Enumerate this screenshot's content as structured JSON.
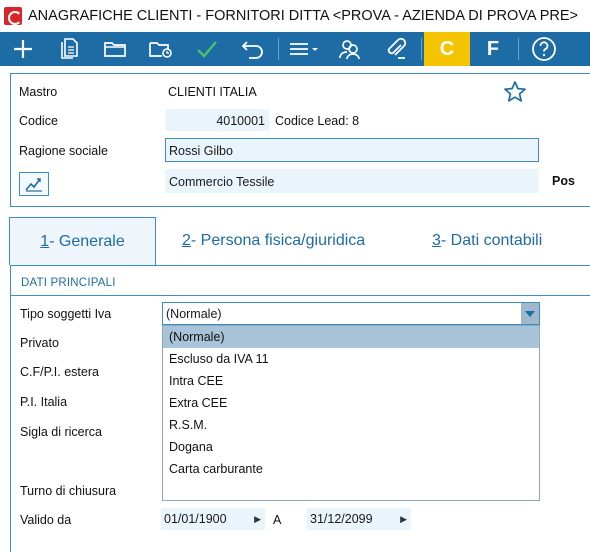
{
  "window": {
    "title": "ANAGRAFICHE CLIENTI - FORNITORI DITTA <PROVA - AZIENDA DI PROVA PRE>"
  },
  "toolbar": {
    "buttons": [
      {
        "name": "new",
        "icon": "plus-icon"
      },
      {
        "name": "copy",
        "icon": "document-icon"
      },
      {
        "name": "open",
        "icon": "folder-icon"
      },
      {
        "name": "search",
        "icon": "folder-search-icon"
      },
      {
        "name": "confirm",
        "icon": "check-icon"
      },
      {
        "name": "undo",
        "icon": "undo-icon"
      },
      {
        "name": "menu",
        "icon": "list-menu-icon"
      },
      {
        "name": "contacts",
        "icon": "people-icon"
      },
      {
        "name": "attach",
        "icon": "paperclip-icon"
      }
    ],
    "c_label": "C",
    "f_label": "F",
    "help_icon": "help-icon",
    "colors": {
      "toolbar": "#1d6ca6",
      "c_button": "#f5c400",
      "check": "#49c46a"
    }
  },
  "header": {
    "mastro_label": "Mastro",
    "mastro_value": "CLIENTI ITALIA",
    "codice_label": "Codice",
    "codice_value": "4010001",
    "codice_lead_label": "Codice Lead: 8",
    "ragione_label": "Ragione sociale",
    "ragione_value": "Rossi Gilbo",
    "descrizione_value": "Commercio Tessile",
    "pos_label": "Pos"
  },
  "tabs": [
    {
      "key": "1",
      "label": " - Generale",
      "active": true
    },
    {
      "key": "2",
      "label": " - Persona fisica/giuridica",
      "active": false
    },
    {
      "key": "3",
      "label": " - Dati contabili",
      "active": false
    }
  ],
  "section": {
    "title": "DATI PRINCIPALI"
  },
  "form": {
    "tipo_label": "Tipo soggetti Iva",
    "tipo_value": "(Normale)",
    "privato_label": "Privato",
    "cf_label": "C.F/P.I. estera",
    "pi_label": "P.I. Italia",
    "sigla_label": "Sigla di ricerca",
    "turno_label": "Turno di chiusura",
    "valido_label": "Valido da",
    "valido_da": "01/01/1900",
    "a_label": "A",
    "valido_a": "31/12/2099"
  },
  "dropdown": {
    "options": [
      "(Normale)",
      "Escluso da IVA 11",
      "Intra CEE",
      "Extra CEE",
      "R.S.M.",
      "Dogana",
      "Carta carburante"
    ],
    "selected_index": 0
  }
}
